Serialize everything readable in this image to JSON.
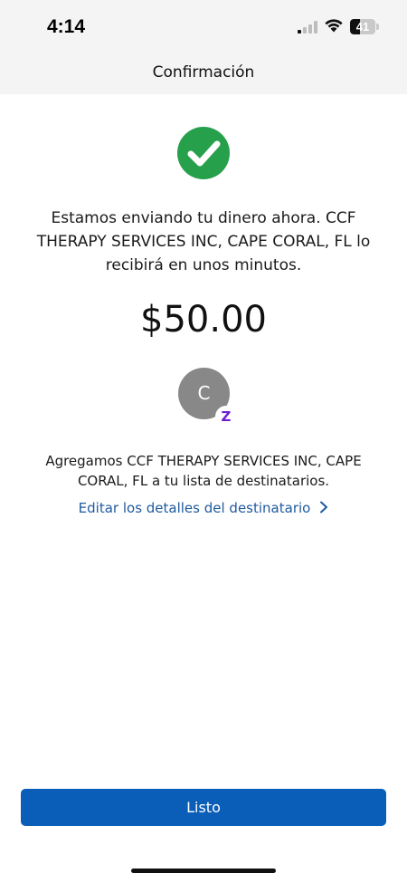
{
  "status_bar": {
    "time": "4:14",
    "battery_level": "41",
    "battery_fill_fraction": 0.41,
    "signal_icon": "cellular-signal-icon",
    "wifi_icon": "wifi-icon",
    "battery_icon": "battery-icon"
  },
  "nav": {
    "title": "Confirmación"
  },
  "confirmation": {
    "check_icon": "check-circle-icon",
    "check_color": "#26a04b",
    "message": "Estamos enviando tu dinero ahora. CCF THERAPY SERVICES INC, CAPE CORAL, FL lo recibirá en unos minutos.",
    "amount": "$50.00"
  },
  "recipient": {
    "avatar_initial": "C",
    "badge_icon": "zelle-icon",
    "badge_glyph": "Z",
    "badge_color": "#6d1ed4",
    "added_text": "Agregamos CCF THERAPY SERVICES INC, CAPE CORAL, FL a tu lista de destinatarios.",
    "edit_link_label": "Editar los detalles del destinatario",
    "edit_link_icon": "chevron-right-icon"
  },
  "footer": {
    "done_label": "Listo",
    "button_color": "#0a5eb8"
  }
}
